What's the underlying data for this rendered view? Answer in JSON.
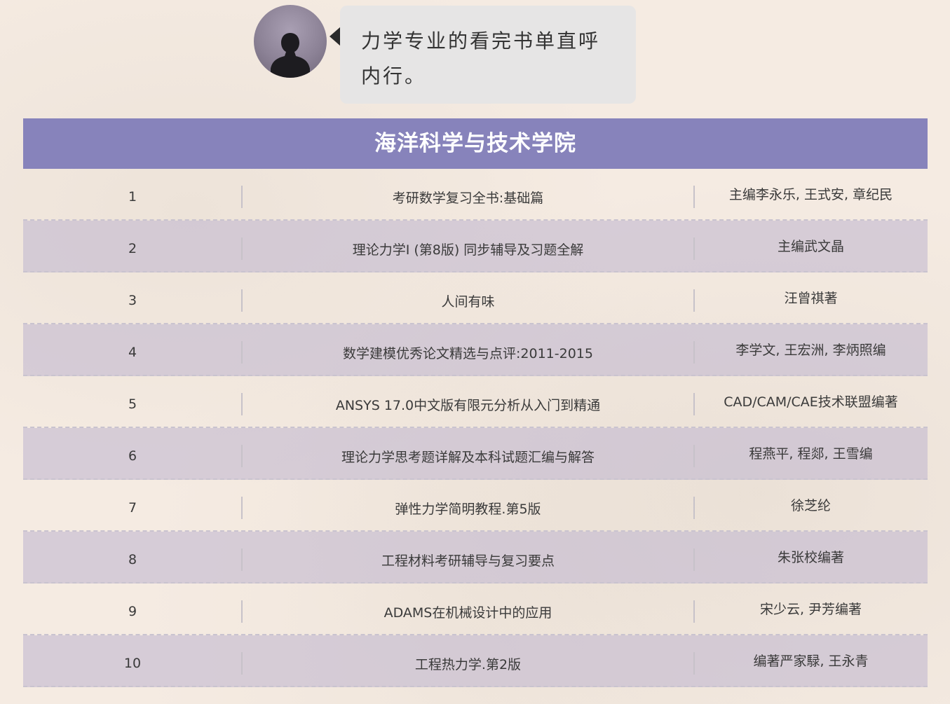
{
  "chat": {
    "message": "力学专业的看完书单直呼内行。"
  },
  "banner": {
    "title": "海洋科学与技术学院"
  },
  "books": [
    {
      "num": "1",
      "title": "考研数学复习全书:基础篇",
      "author": "主编李永乐, 王式安, 章纪民"
    },
    {
      "num": "2",
      "title": "理论力学I (第8版) 同步辅导及习题全解",
      "author": "主编武文晶"
    },
    {
      "num": "3",
      "title": "人间有味",
      "author": "汪曾祺著"
    },
    {
      "num": "4",
      "title": "数学建模优秀论文精选与点评:2011-2015",
      "author": "李学文, 王宏洲, 李炳照编"
    },
    {
      "num": "5",
      "title": "ANSYS 17.0中文版有限元分析从入门到精通",
      "author": "CAD/CAM/CAE技术联盟编著"
    },
    {
      "num": "6",
      "title": "理论力学思考题详解及本科试题汇编与解答",
      "author": "程燕平, 程郯, 王雪编"
    },
    {
      "num": "7",
      "title": "弹性力学简明教程.第5版",
      "author": "徐芝纶"
    },
    {
      "num": "8",
      "title": "工程材料考研辅导与复习要点",
      "author": "朱张校编著"
    },
    {
      "num": "9",
      "title": "ADAMS在机械设计中的应用",
      "author": "宋少云, 尹芳编著"
    },
    {
      "num": "10",
      "title": "工程热力学.第2版",
      "author": "编著严家騄, 王永青"
    }
  ],
  "colors": {
    "background": "#f5ebe2",
    "banner": "#8783bb",
    "row_alt": "#c4bad1",
    "bubble": "#e6e5e5"
  },
  "icons": {
    "avatar": "person-silhouette-icon"
  }
}
